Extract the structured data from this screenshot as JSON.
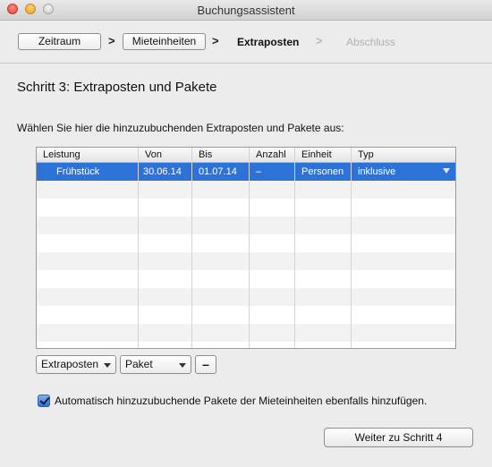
{
  "window": {
    "title": "Buchungsassistent"
  },
  "steps": {
    "zeitraum": "Zeitraum",
    "mieteinheiten": "Mieteinheiten",
    "extraposten": "Extraposten",
    "abschluss": "Abschluss",
    "separator": ">"
  },
  "heading": "Schritt 3: Extraposten und Pakete",
  "description": "Wählen Sie hier die hinzuzubuchenden Extraposten und Pakete aus:",
  "table": {
    "columns": [
      "Leistung",
      "Von",
      "Bis",
      "Anzahl",
      "Einheit",
      "Typ"
    ],
    "rows": [
      {
        "leistung": "Frühstück",
        "von": "30.06.14",
        "bis": "01.07.14",
        "anzahl": "–",
        "einheit": "Personen",
        "typ": "inklusive",
        "selected": true
      }
    ]
  },
  "controls": {
    "extraposten_popup": "Extraposten",
    "paket_popup": "Paket",
    "remove_label": "–"
  },
  "checkbox": {
    "label": "Automatisch hinzuzubuchende Pakete der Mieteinheiten ebenfalls hinzufügen.",
    "checked": true
  },
  "next_button": "Weiter zu Schritt 4",
  "colors": {
    "selection": "#2d72d6",
    "disabled_text": "#b0b0b0"
  }
}
